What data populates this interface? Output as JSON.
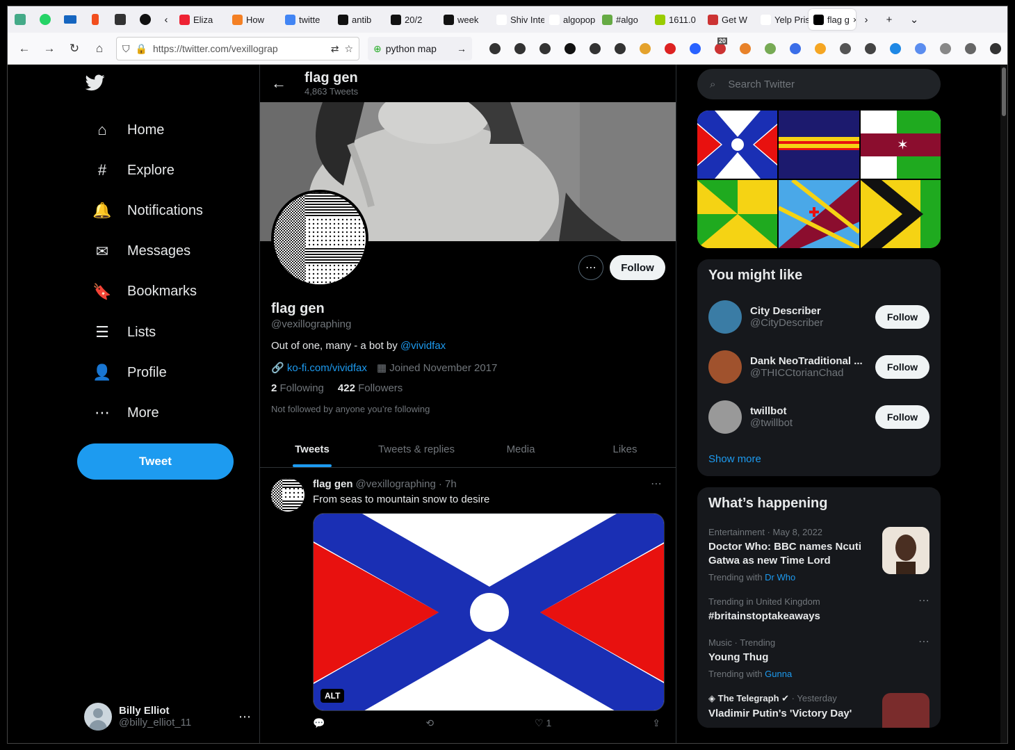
{
  "browser": {
    "tabs": [
      {
        "label": "",
        "color": "#4a8"
      },
      {
        "label": "",
        "color": "#25d366"
      },
      {
        "label": "",
        "color": "#1565c0"
      },
      {
        "label": "",
        "color": "#f24e1e"
      },
      {
        "label": "",
        "color": "#333"
      },
      {
        "label": "",
        "color": "#111"
      }
    ],
    "named_tabs": [
      {
        "label": "Eliza",
        "color": "#e23"
      },
      {
        "label": "How",
        "color": "#f48024"
      },
      {
        "label": "twitte",
        "color": "#4285f4"
      },
      {
        "label": "antib",
        "color": "#111"
      },
      {
        "label": "20/2",
        "color": "#111"
      },
      {
        "label": "week",
        "color": "#111"
      },
      {
        "label": "Shiv Inte",
        "color": "#fff"
      },
      {
        "label": "algopop",
        "color": "#fff"
      },
      {
        "label": "#algo",
        "color": "#6a4"
      },
      {
        "label": "1611.0",
        "color": "#9c0"
      },
      {
        "label": "Get W",
        "color": "#c33"
      },
      {
        "label": "Yelp Pris",
        "color": "#fff"
      },
      {
        "label": "flag g",
        "color": "#000"
      }
    ],
    "active_tab": "flag",
    "url": "https://twitter.com/vexillograp",
    "bookmark": "python map",
    "badge": "20"
  },
  "nav": {
    "items": [
      {
        "label": "Home",
        "icon": "home-icon",
        "glyph": "⌂"
      },
      {
        "label": "Explore",
        "icon": "hashtag-icon",
        "glyph": "#"
      },
      {
        "label": "Notifications",
        "icon": "bell-icon",
        "glyph": "🔔"
      },
      {
        "label": "Messages",
        "icon": "envelope-icon",
        "glyph": "✉"
      },
      {
        "label": "Bookmarks",
        "icon": "bookmark-icon",
        "glyph": "🔖"
      },
      {
        "label": "Lists",
        "icon": "list-icon",
        "glyph": "☰"
      },
      {
        "label": "Profile",
        "icon": "person-icon",
        "glyph": "👤"
      },
      {
        "label": "More",
        "icon": "more-circle-icon",
        "glyph": "⋯"
      }
    ],
    "tweet_label": "Tweet",
    "account": {
      "name": "Billy Elliot",
      "handle": "@billy_elliot_11"
    }
  },
  "profile": {
    "header_name": "flag gen",
    "tweet_count": "4,863 Tweets",
    "name": "flag gen",
    "handle": "@vexillographing",
    "bio_prefix": "Out of one, many - a bot by ",
    "bio_link": "@vividfax",
    "website": "ko-fi.com/vividfax",
    "joined": "Joined November 2017",
    "following_count": "2",
    "following_label": "Following",
    "followers_count": "422",
    "followers_label": "Followers",
    "not_followed": "Not followed by anyone you’re following",
    "follow_label": "Follow",
    "tabs": [
      "Tweets",
      "Tweets & replies",
      "Media",
      "Likes"
    ]
  },
  "tweet": {
    "name": "flag gen",
    "handle": "@vexillographing",
    "time": "· 7h",
    "text": "From seas to mountain snow to desire",
    "alt": "ALT",
    "likes": "1"
  },
  "right": {
    "search_placeholder": "Search Twitter",
    "might_like_title": "You might like",
    "suggestions": [
      {
        "name": "City Describer",
        "handle": "@CityDescriber",
        "color": "#3a7ca5"
      },
      {
        "name": "Dank NeoTraditional ...",
        "handle": "@THICCtorianChad",
        "color": "#a0522d"
      },
      {
        "name": "twillbot",
        "handle": "@twillbot",
        "color": "#999"
      }
    ],
    "follow_label": "Follow",
    "show_more": "Show more",
    "happening_title": "What’s happening",
    "trends": [
      {
        "meta": "Entertainment · May 8, 2022",
        "title": "Doctor Who: BBC names Ncuti Gatwa as new Time Lord",
        "with_prefix": "Trending with ",
        "with": "Dr Who"
      },
      {
        "meta": "Trending in United Kingdom",
        "title": "#britainstoptakeaways",
        "with_prefix": "",
        "with": ""
      },
      {
        "meta": "Music · Trending",
        "title": "Young Thug",
        "with_prefix": "Trending with ",
        "with": "Gunna"
      },
      {
        "meta": "The Telegraph",
        "meta2": "· Yesterday",
        "title": "Vladimir Putin's 'Victory Day'",
        "with_prefix": "",
        "with": ""
      }
    ]
  },
  "colors": {
    "accent": "#1d9bf0",
    "flag_blue": "#1a2fb4",
    "flag_red": "#e8110f"
  }
}
